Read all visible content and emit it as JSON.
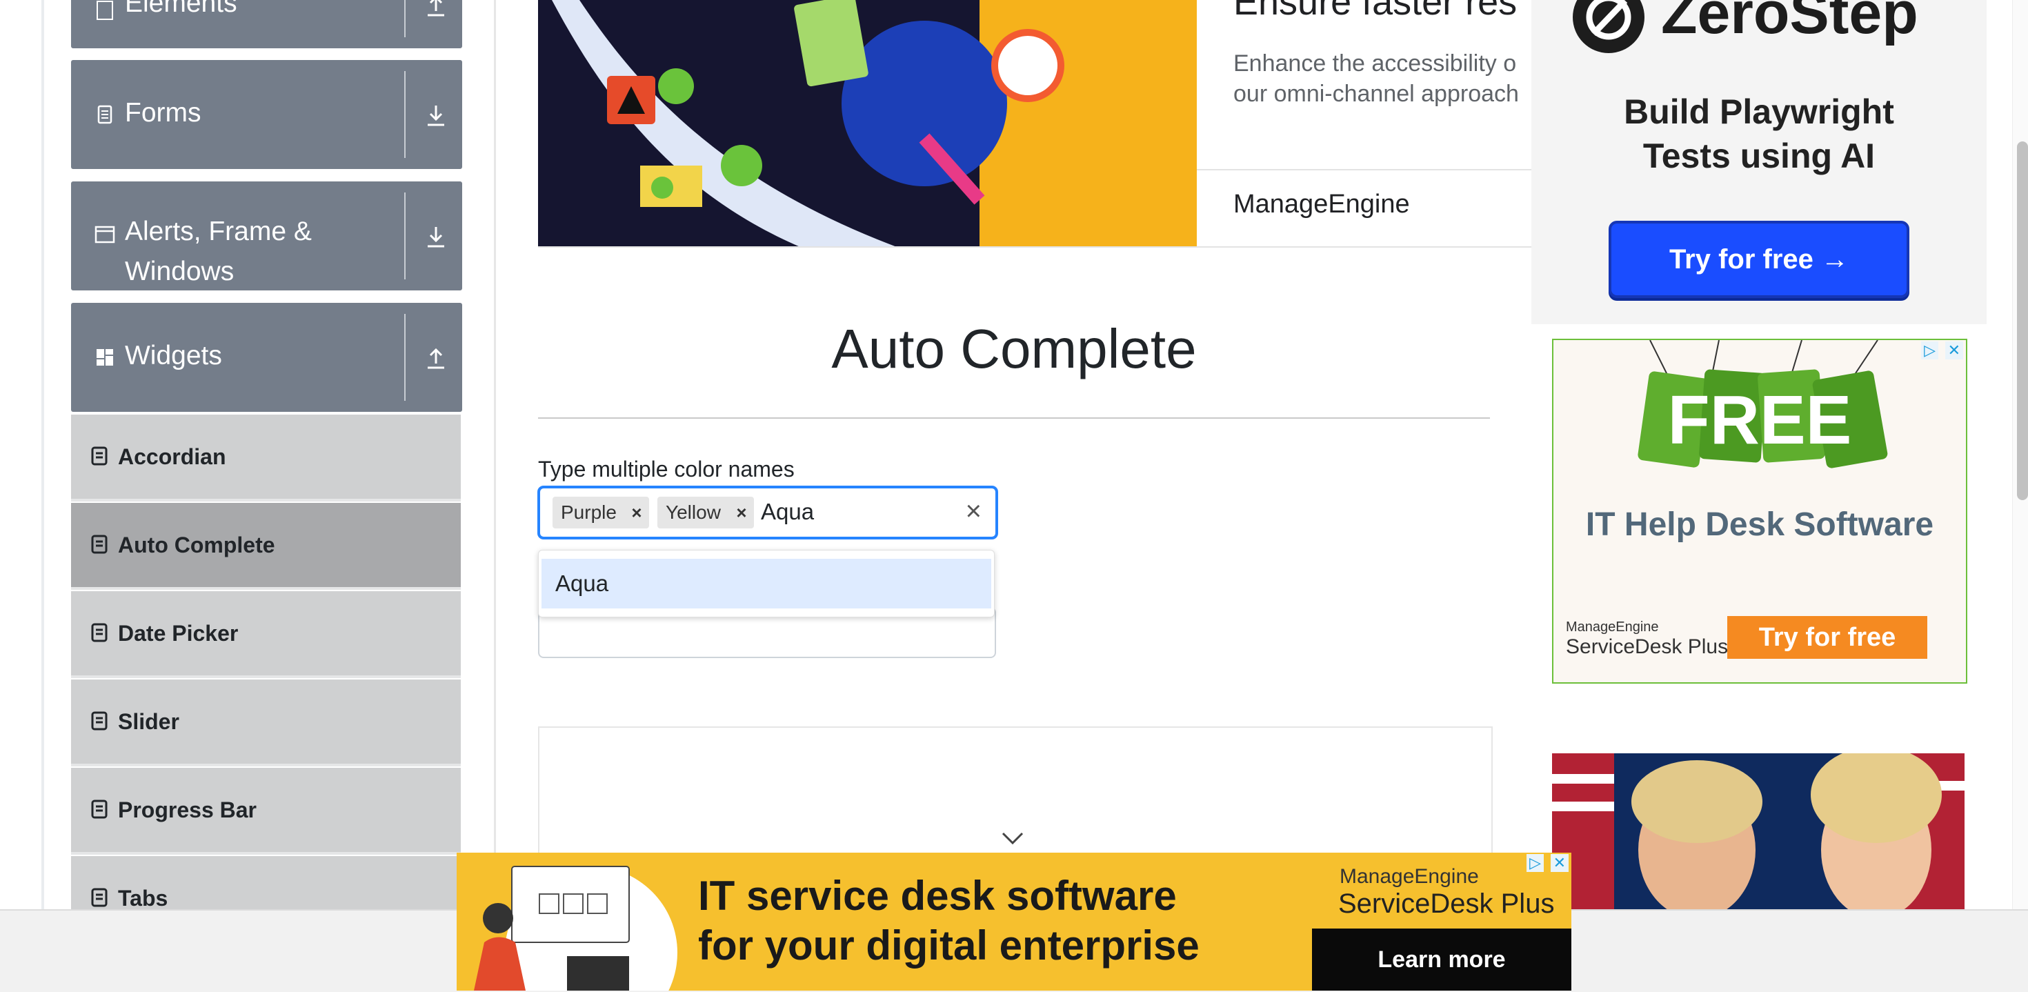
{
  "sidebar": {
    "groups": [
      {
        "label": "Elements",
        "icon": "list-icon",
        "arrow": "collapse-arrow-icon"
      },
      {
        "label": "Forms",
        "icon": "document-icon",
        "arrow": "expand-arrow-icon"
      },
      {
        "label": "Alerts, Frame & Windows",
        "icon": "window-icon",
        "arrow": "expand-arrow-icon"
      },
      {
        "label": "Widgets",
        "icon": "grid-icon",
        "arrow": "collapse-arrow-icon"
      }
    ],
    "widget_items": [
      "Accordian",
      "Auto Complete",
      "Date Picker",
      "Slider",
      "Progress Bar",
      "Tabs"
    ],
    "active_item": "Auto Complete"
  },
  "top_ad": {
    "headline": "Ensure faster res",
    "copy_line1": "Enhance the accessibility o",
    "copy_line2": "our omni-channel approach",
    "brand": "ManageEngine"
  },
  "main": {
    "title": "Auto Complete",
    "multi_label": "Type multiple color names",
    "chips": [
      "Purple",
      "Yellow"
    ],
    "typed_text": "Aqua",
    "dropdown_options": [
      "Aqua"
    ]
  },
  "right_ads": {
    "zerostep": {
      "logo": "ZeroStep",
      "tagline_line1": "Build Playwright",
      "tagline_line2": "Tests using AI",
      "cta": "Try for free →"
    },
    "free": {
      "badge": "FREE",
      "title": "IT Help Desk Software",
      "vendor": "ManageEngine",
      "product": "ServiceDesk Plus",
      "cta": "Try for free"
    }
  },
  "bottom_ad": {
    "line1": "IT service desk software",
    "line2": "for your digital enterprise",
    "vendor": "ManageEngine",
    "product": "ServiceDesk Plus",
    "cta": "Learn more"
  },
  "colors": {
    "group_bg": "#747d8a",
    "sub_bg": "#cfd0d1",
    "sub_active": "#a8a9ab",
    "focus": "#2684ff",
    "option_hover": "#deebff"
  }
}
